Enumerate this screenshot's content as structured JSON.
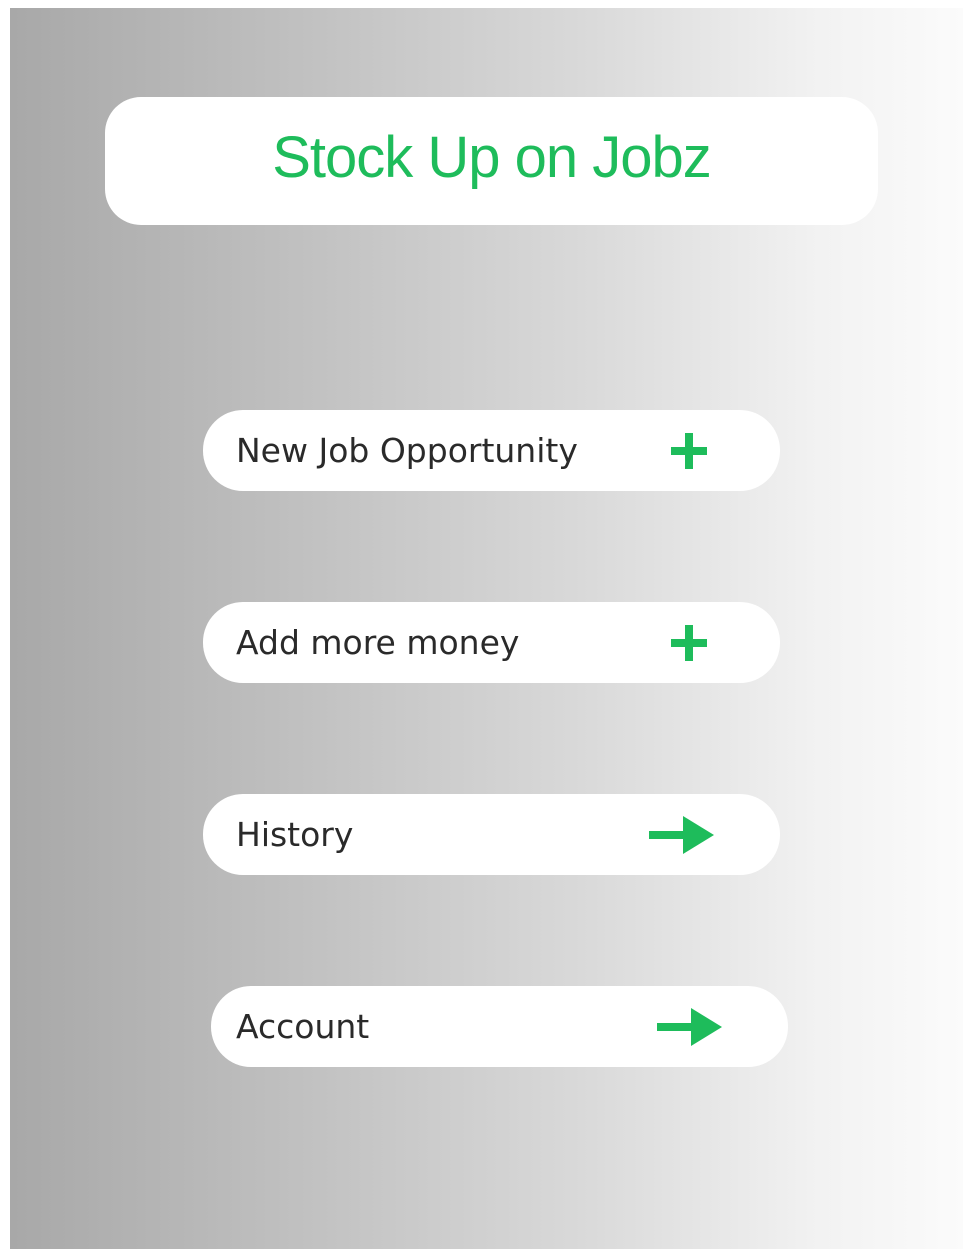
{
  "app": {
    "title": "Stock Up on Jobz"
  },
  "menu": {
    "items": [
      {
        "label": "New Job Opportunity",
        "icon": "plus-icon"
      },
      {
        "label": "Add more money",
        "icon": "plus-icon"
      },
      {
        "label": "History",
        "icon": "arrow-right-icon"
      },
      {
        "label": "Account",
        "icon": "arrow-right-icon"
      }
    ]
  },
  "colors": {
    "accent": "#1ebc5b",
    "text": "#2a2a2a",
    "card": "#ffffff"
  }
}
